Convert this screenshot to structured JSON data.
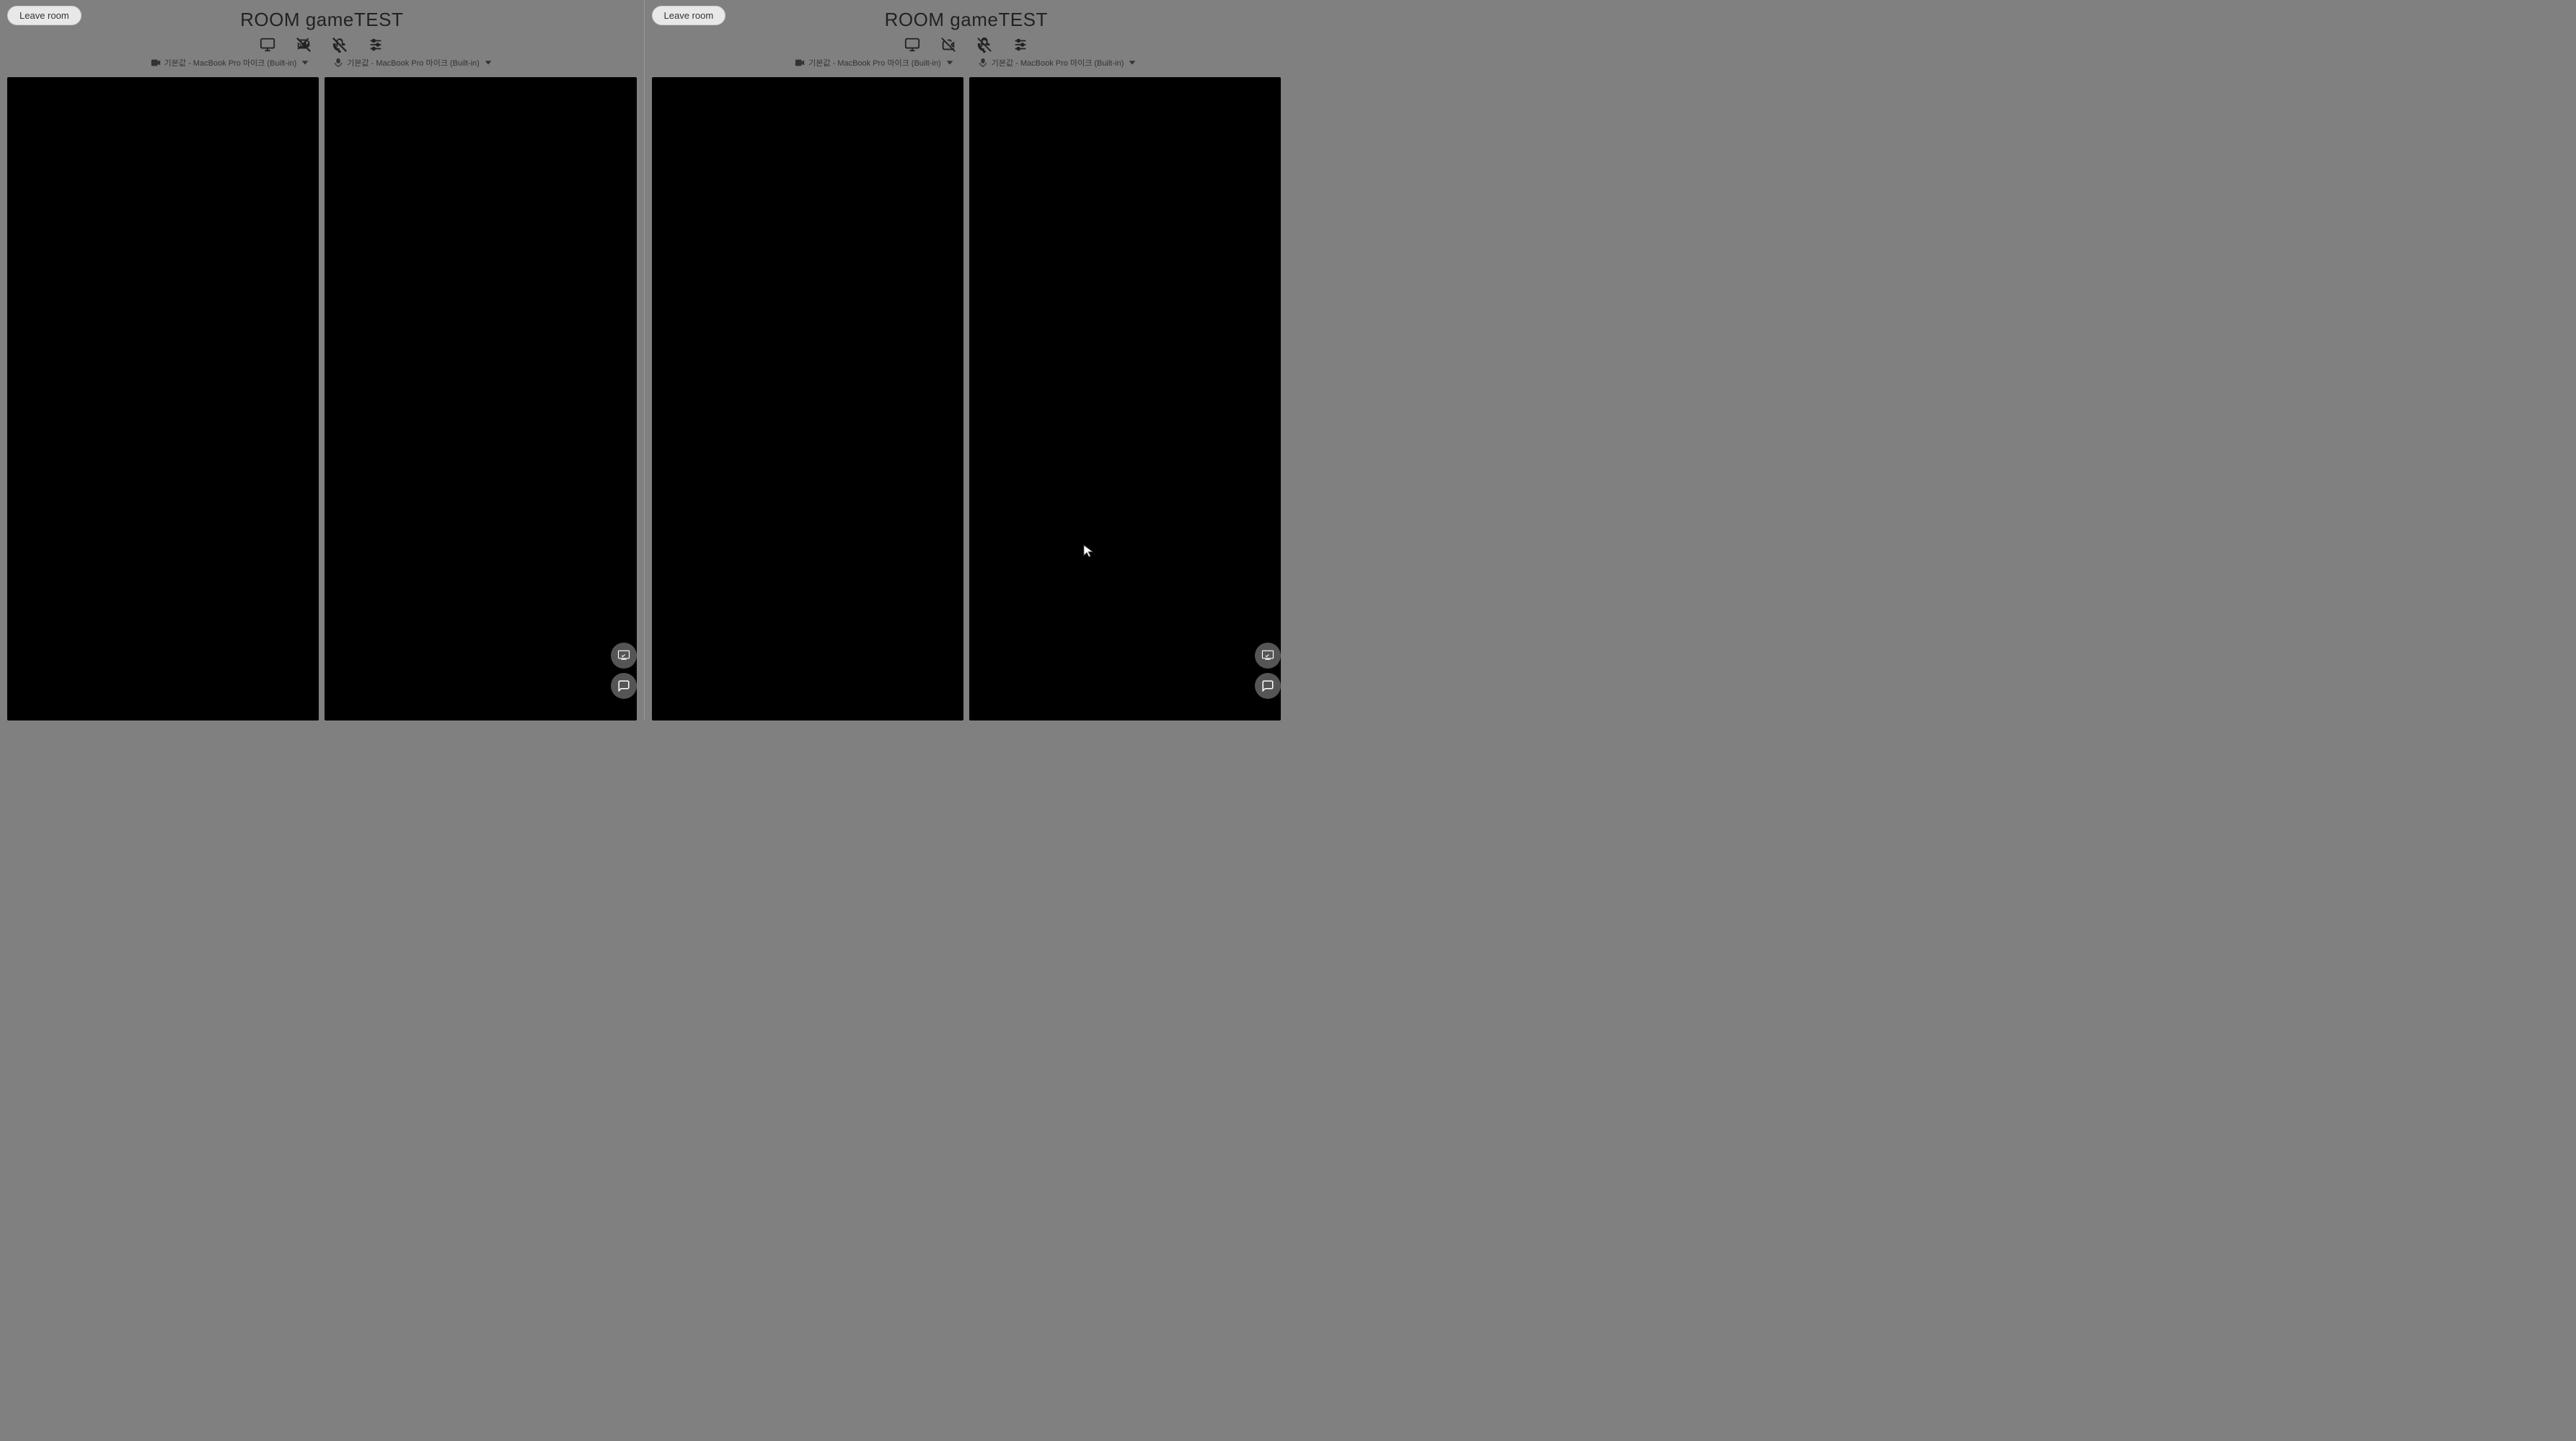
{
  "left_panel": {
    "leave_button": "Leave room",
    "room_title": "ROOM gameTEST",
    "device_camera": "기본값 - MacBook Pro 마이크 (Built-in)",
    "device_mic": "기본값 - MacBook Pro 마이크 (Built-in)",
    "controls": {
      "screen_share": "screen-share-icon",
      "camera_off": "camera-off-icon",
      "mic_off": "mic-off-icon",
      "settings": "settings-icon"
    }
  },
  "right_panel": {
    "leave_button": "Leave room",
    "room_title": "ROOM gameTEST",
    "device_camera": "기본값 - MacBook Pro 마이크 (Built-in)",
    "device_mic": "기본값 - MacBook Pro 마이크 (Built-in)",
    "controls": {
      "screen_share": "screen-share-icon",
      "camera_off": "camera-off-icon",
      "mic_off": "mic-off-icon",
      "settings": "settings-icon"
    }
  },
  "colors": {
    "background": "#808080",
    "video_bg": "#000000",
    "leave_btn_bg": "#e8e8e8",
    "title_color": "#222222"
  }
}
